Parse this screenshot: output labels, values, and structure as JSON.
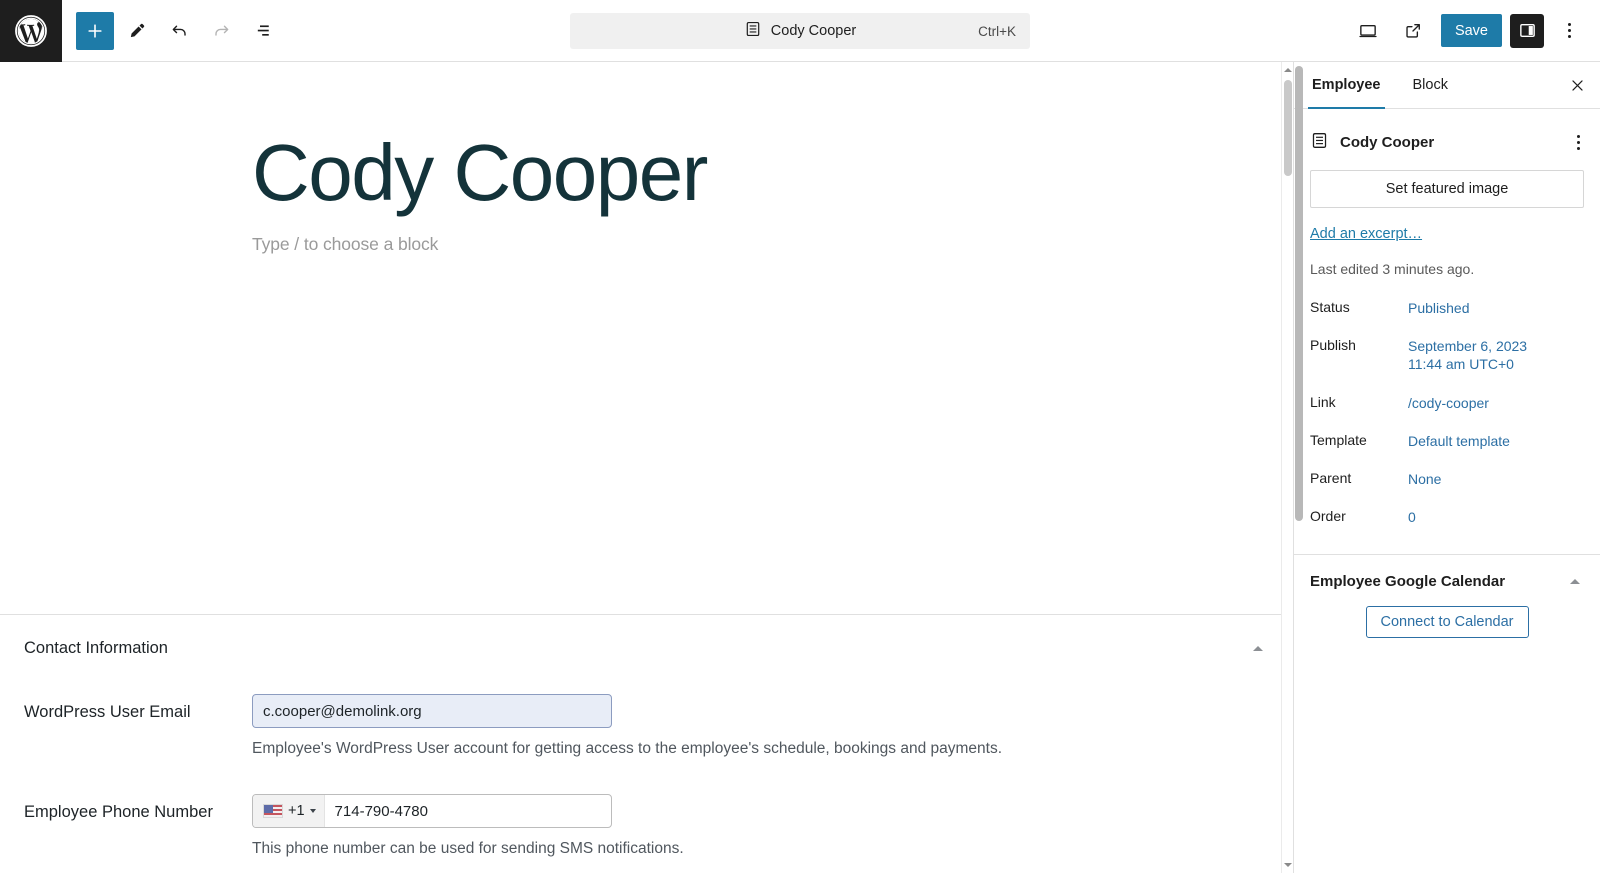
{
  "toolbar": {
    "logo_icon": "wordpress-logo-icon",
    "add_block_label": "+",
    "add_block_icon": "plus-icon",
    "tools_icon": "pencil-edit-icon",
    "undo_icon": "undo-arrow-icon",
    "redo_icon": "redo-arrow-icon",
    "list_view_icon": "document-overview-list-icon",
    "command_bar": {
      "icon": "page-document-icon",
      "title": "Cody Cooper",
      "shortcut": "Ctrl+K"
    },
    "preview_icon": "desktop-preview-icon",
    "view_external_icon": "external-link-icon",
    "save_label": "Save",
    "settings_toggle_icon": "settings-sidebar-icon",
    "options_icon": "kebab-menu-icon"
  },
  "editor": {
    "post_title": "Cody Cooper",
    "block_placeholder": "Type / to choose a block"
  },
  "metabox": {
    "title": "Contact Information",
    "collapse_icon": "triangle-up-icon",
    "fields": [
      {
        "label": "WordPress User Email",
        "value": "c.cooper@demolink.org",
        "placeholder": "",
        "help": "Employee's WordPress User account for getting access to the employee's schedule, bookings and payments."
      },
      {
        "label": "Employee Phone Number",
        "country_flag": "us-flag-icon",
        "country_code": "+1",
        "value": "714-790-4780",
        "placeholder": "",
        "help": "This phone number can be used for sending SMS notifications."
      }
    ]
  },
  "sidebar": {
    "tabs": [
      {
        "label": "Employee",
        "active": true
      },
      {
        "label": "Block",
        "active": false
      }
    ],
    "close_icon": "close-x-icon",
    "document": {
      "icon": "page-document-icon",
      "title": "Cody Cooper",
      "actions_icon": "kebab-menu-icon"
    },
    "featured_image_label": "Set featured image",
    "excerpt_link": "Add an excerpt…",
    "last_edited": "Last edited 3 minutes ago.",
    "meta": [
      {
        "key": "Status",
        "value": "Published",
        "value2": ""
      },
      {
        "key": "Publish",
        "value": "September 6, 2023",
        "value2": "11:44 am UTC+0"
      },
      {
        "key": "Link",
        "value": "/cody-cooper",
        "value2": ""
      },
      {
        "key": "Template",
        "value": "Default template",
        "value2": ""
      },
      {
        "key": "Parent",
        "value": "None",
        "value2": ""
      },
      {
        "key": "Order",
        "value": "0",
        "value2": ""
      }
    ],
    "section": {
      "title": "Employee Google Calendar",
      "toggle_icon": "triangle-up-icon",
      "connect_label": "Connect to Calendar"
    }
  },
  "colors": {
    "accent_blue": "#1e7ba8",
    "link_blue": "#2c6fa4",
    "title_teal": "#14333a",
    "field_fill": "#e8edf7"
  }
}
